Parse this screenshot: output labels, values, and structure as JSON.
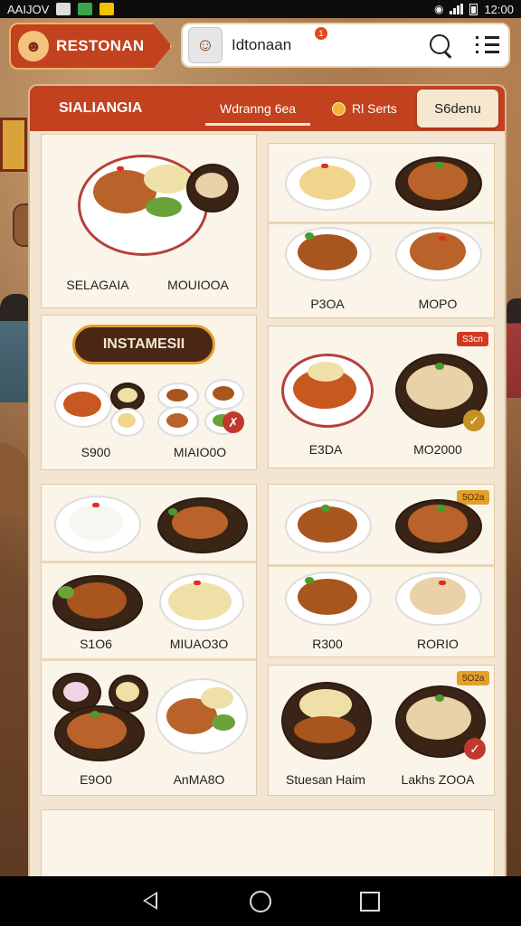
{
  "status_bar": {
    "carrier": "AAIJOV",
    "time": "12:00"
  },
  "header": {
    "brand_name": "RESTONAN",
    "search_text": "Idtonaan",
    "notification_count": "1"
  },
  "tabs": [
    {
      "label": "SIALIANGIA"
    },
    {
      "label": "Wdranng 6ea"
    },
    {
      "label": "Rl Serts"
    },
    {
      "label": "S6denu"
    }
  ],
  "instant_banner": "INSTAMESII",
  "cards": [
    {
      "labels": [
        "SELAGAIA",
        "MOUIOOA"
      ]
    },
    {
      "labels": [
        "P3OA",
        "MOPO"
      ]
    },
    {
      "labels": [
        "S900",
        "MIAIO0O"
      ]
    },
    {
      "labels": [
        "E3DA",
        "MO2000"
      ],
      "tag": "S3cn"
    },
    {
      "labels": [
        "S1O6",
        "MIUAO3O"
      ]
    },
    {
      "labels": [
        "R300",
        "RORIO"
      ],
      "tag": "5O2a"
    },
    {
      "labels": [
        "E9O0",
        "AnMA8O"
      ]
    },
    {
      "labels": [
        "Stuesan Haim",
        "Lakhs ZOOA"
      ],
      "tag": "5O2a"
    }
  ],
  "colors": {
    "brand_red": "#c2411f",
    "panel_bg": "#f2e6d2",
    "card_bg": "#fbf4e8",
    "gold": "#e0a128"
  }
}
